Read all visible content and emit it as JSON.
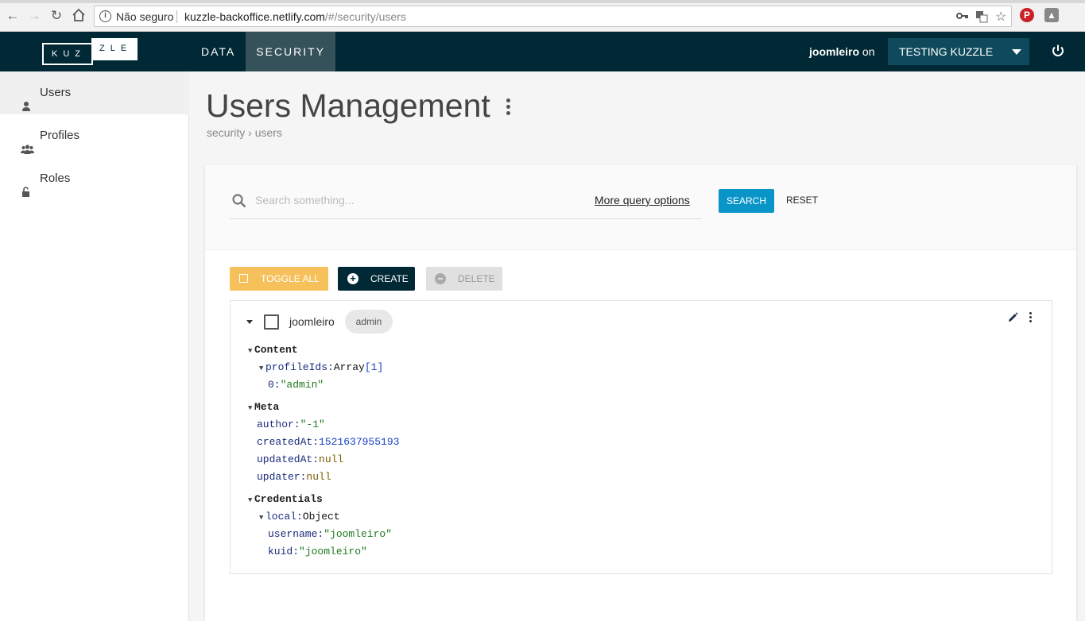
{
  "browser": {
    "security_label": "Não seguro",
    "url_host": "kuzzle-backoffice.netlify.com",
    "url_path": "/#/security/users"
  },
  "header": {
    "logo_left": "KUZ",
    "logo_right": "ZLE",
    "nav": [
      {
        "label": "DATA",
        "active": false
      },
      {
        "label": "SECURITY",
        "active": true
      }
    ],
    "username": "joomleiro",
    "on_label": "on",
    "environment": "TESTING KUZZLE"
  },
  "sidebar": {
    "items": [
      {
        "label": "Users",
        "icon": "user-icon",
        "active": true
      },
      {
        "label": "Profiles",
        "icon": "group-icon",
        "active": false
      },
      {
        "label": "Roles",
        "icon": "unlock-icon",
        "active": false
      }
    ]
  },
  "page": {
    "title": "Users Management",
    "breadcrumb": [
      "security",
      "users"
    ]
  },
  "search": {
    "placeholder": "Search something...",
    "more_options": "More query options",
    "search_label": "SEARCH",
    "reset_label": "RESET"
  },
  "actions": {
    "toggle_all": "TOGGLE ALL",
    "create": "CREATE",
    "delete": "DELETE"
  },
  "user": {
    "id": "joomleiro",
    "profile_badge": "admin",
    "content": {
      "header": "Content",
      "profileIds_key": "profileIds:",
      "profileIds_type": "Array",
      "profileIds_count": "[1]",
      "item0_key": "0:",
      "item0_value": "\"admin\""
    },
    "meta": {
      "header": "Meta",
      "author_key": "author:",
      "author_value": "\"-1\"",
      "createdAt_key": "createdAt:",
      "createdAt_value": "1521637955193",
      "updatedAt_key": "updatedAt:",
      "updatedAt_value": "null",
      "updater_key": "updater:",
      "updater_value": "null"
    },
    "credentials": {
      "header": "Credentials",
      "local_key": "local:",
      "local_type": "Object",
      "username_key": "username:",
      "username_value": "\"joomleiro\"",
      "kuid_key": "kuid:",
      "kuid_value": "\"joomleiro\""
    }
  },
  "colors": {
    "header_bg": "#002835",
    "accent_blue": "#0a95c9",
    "toggle_yellow": "#f6c15a"
  }
}
